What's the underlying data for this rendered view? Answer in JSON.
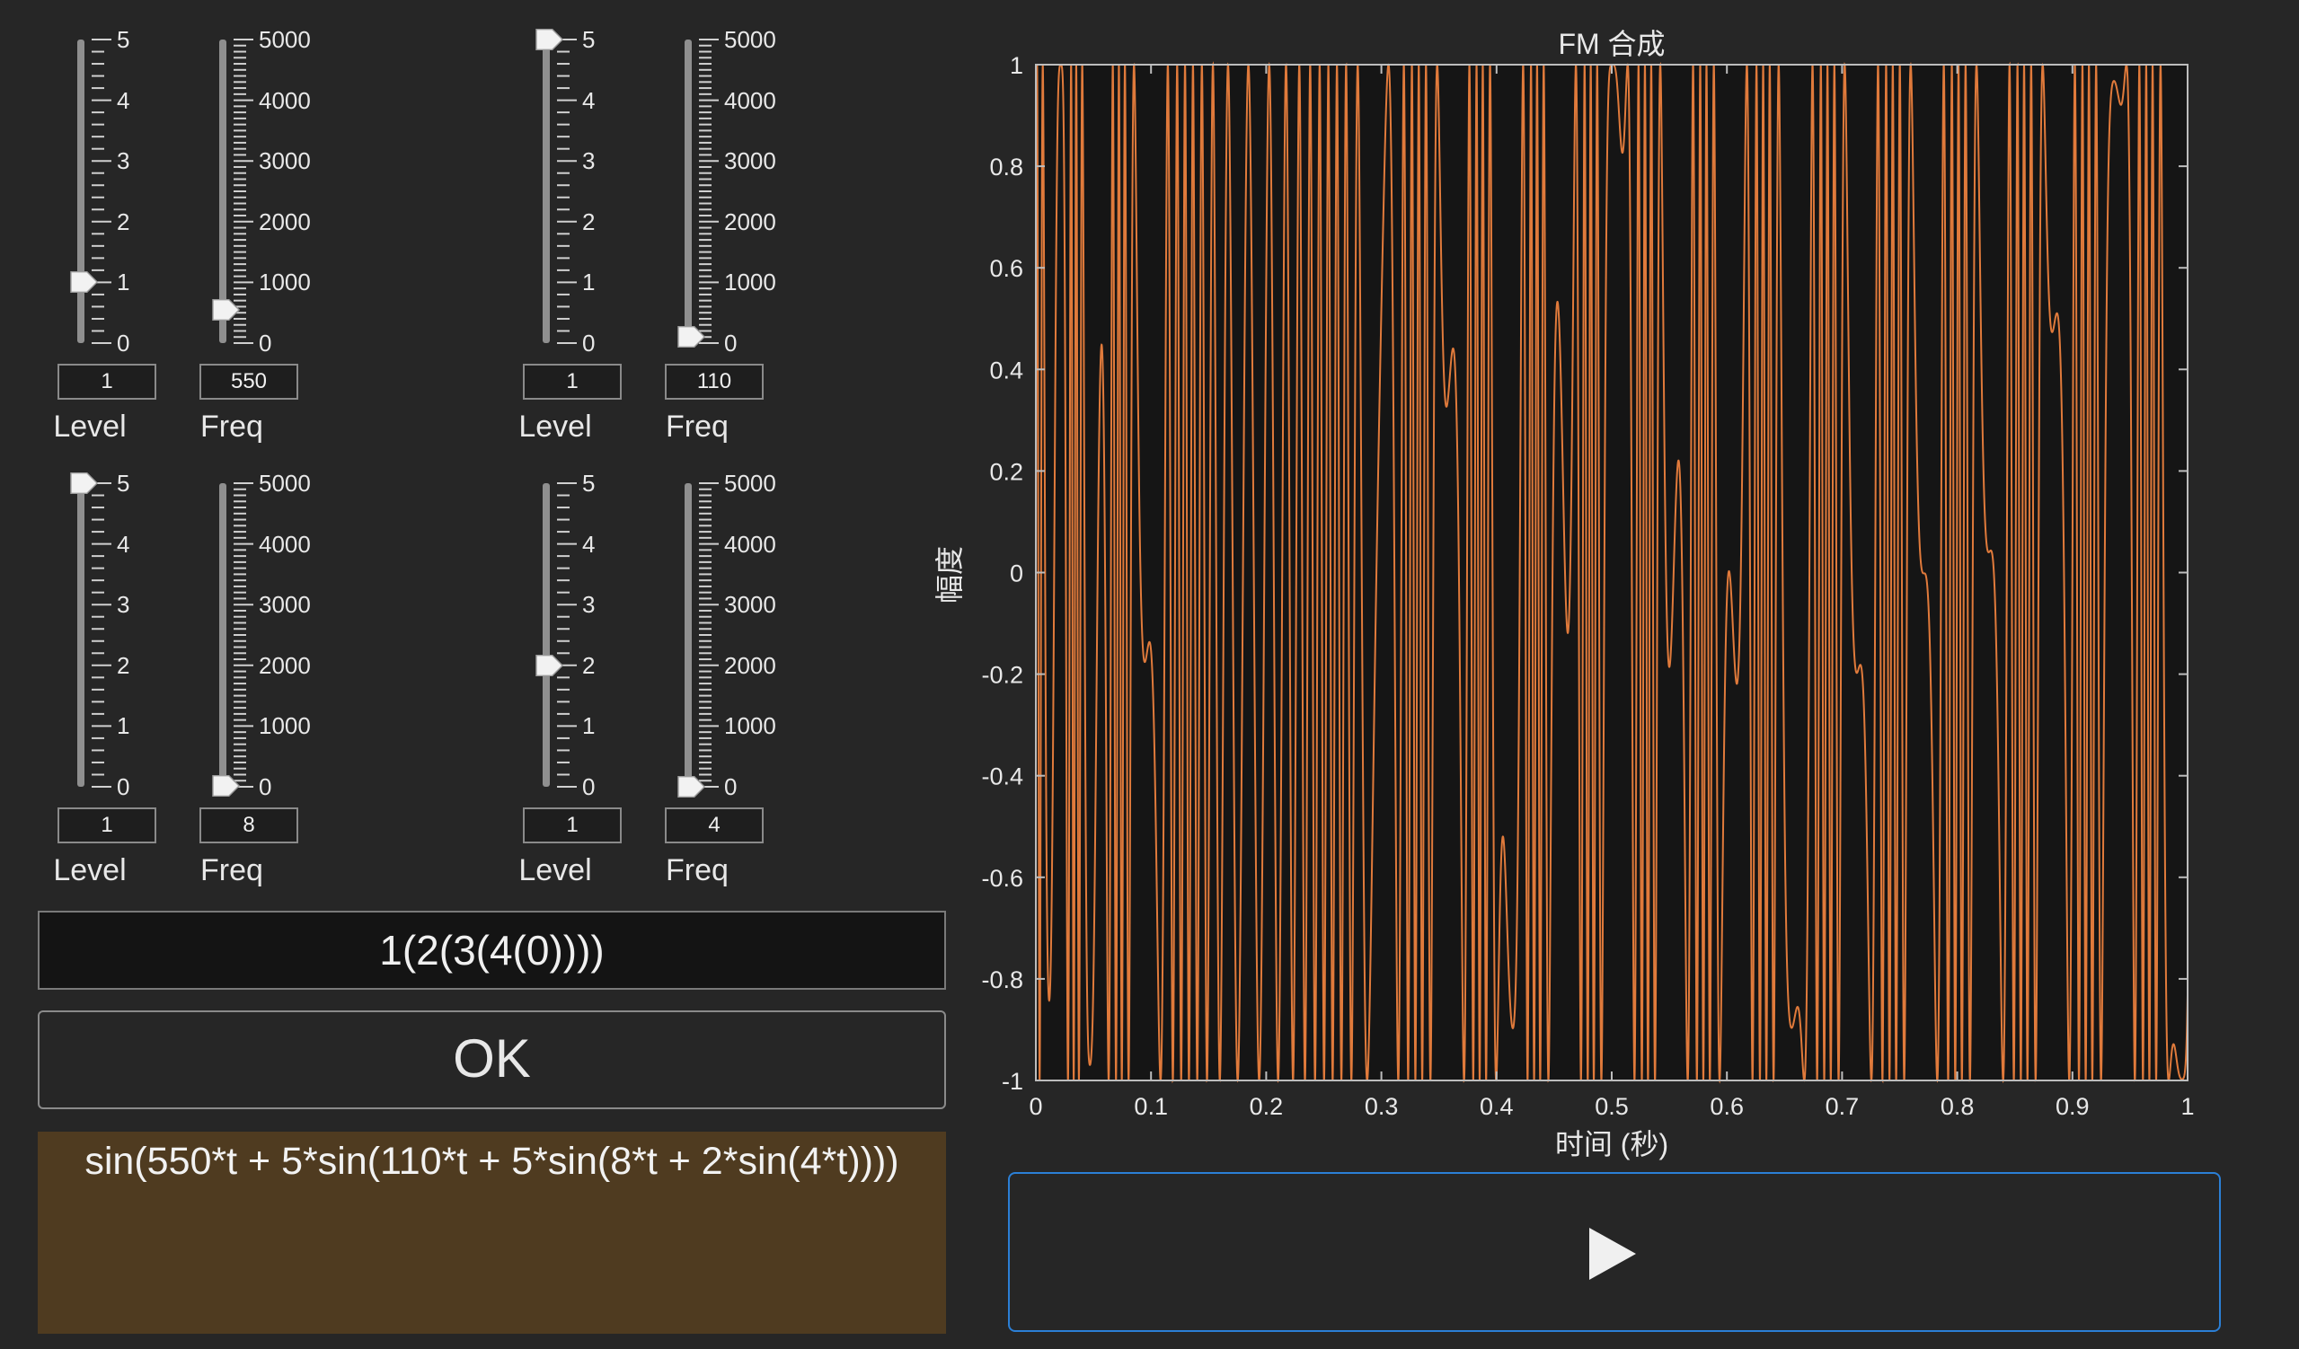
{
  "colors": {
    "background": "#262626",
    "plot_background": "#151515",
    "trace": "#e07a3b",
    "formula_background": "#4f3b20",
    "play_border": "#2b7fd6"
  },
  "operators": [
    {
      "level": {
        "value": 1,
        "display": "1",
        "label": "Level",
        "max": 5,
        "ticks": [
          "5",
          "4",
          "3",
          "2",
          "1",
          "0"
        ]
      },
      "freq": {
        "value": 550,
        "display": "550",
        "label": "Freq",
        "max": 5000,
        "ticks": [
          "5000",
          "4000",
          "3000",
          "2000",
          "1000",
          "0"
        ]
      }
    },
    {
      "level": {
        "value": 5,
        "display": "1",
        "label": "Level",
        "max": 5,
        "ticks": [
          "5",
          "4",
          "3",
          "2",
          "1",
          "0"
        ]
      },
      "freq": {
        "value": 110,
        "display": "110",
        "label": "Freq",
        "max": 5000,
        "ticks": [
          "5000",
          "4000",
          "3000",
          "2000",
          "1000",
          "0"
        ]
      }
    },
    {
      "level": {
        "value": 5,
        "display": "1",
        "label": "Level",
        "max": 5,
        "ticks": [
          "5",
          "4",
          "3",
          "2",
          "1",
          "0"
        ]
      },
      "freq": {
        "value": 8,
        "display": "8",
        "label": "Freq",
        "max": 5000,
        "ticks": [
          "5000",
          "4000",
          "3000",
          "2000",
          "1000",
          "0"
        ]
      }
    },
    {
      "level": {
        "value": 2,
        "display": "1",
        "label": "Level",
        "max": 5,
        "ticks": [
          "5",
          "4",
          "3",
          "2",
          "1",
          "0"
        ]
      },
      "freq": {
        "value": 4,
        "display": "4",
        "label": "Freq",
        "max": 5000,
        "ticks": [
          "5000",
          "4000",
          "3000",
          "2000",
          "1000",
          "0"
        ]
      }
    }
  ],
  "algorithm_expression": "1(2(3(4(0))))",
  "ok_label": "OK",
  "formula_text": "sin(550*t + 5*sin(110*t + 5*sin(8*t + 2*sin(4*t))))",
  "play_icon": "play-icon",
  "chart_data": {
    "type": "line",
    "title": "FM 合成",
    "xlabel": "时间 (秒)",
    "ylabel": "幅度",
    "xlim": [
      0,
      1
    ],
    "ylim": [
      -1,
      1
    ],
    "xticks": [
      "0",
      "0.1",
      "0.2",
      "0.3",
      "0.4",
      "0.5",
      "0.6",
      "0.7",
      "0.8",
      "0.9",
      "1"
    ],
    "yticks": [
      "1",
      "0.8",
      "0.6",
      "0.4",
      "0.2",
      "0",
      "-0.2",
      "-0.4",
      "-0.6",
      "-0.8",
      "-1"
    ],
    "grid": false,
    "series": [
      {
        "function": "sin(550*t + 5*sin(110*t + 5*sin(8*t + 2*sin(4*t))))",
        "t_range": [
          0,
          1
        ]
      }
    ]
  }
}
